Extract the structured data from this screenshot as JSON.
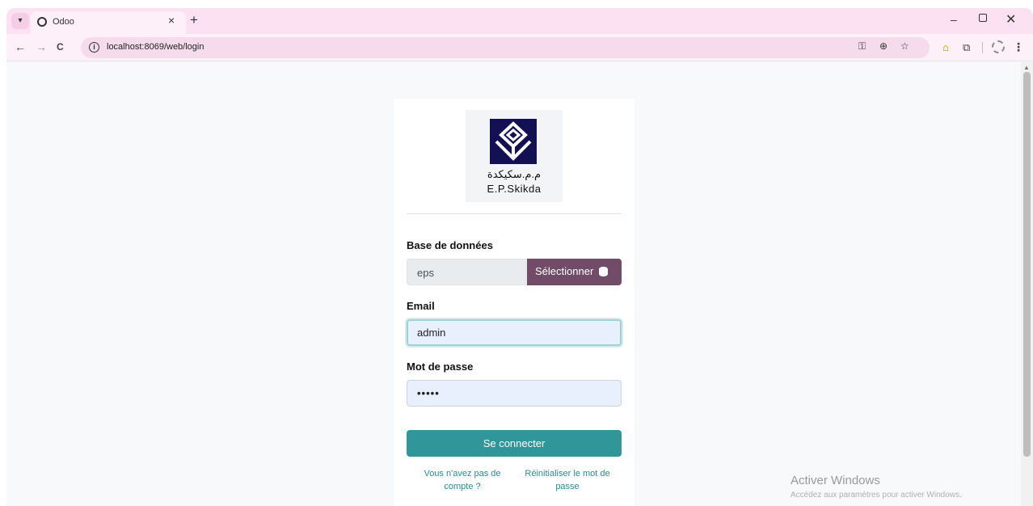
{
  "browser": {
    "tab_title": "Odoo",
    "tab_close": "×",
    "new_tab": "+",
    "url": "localhost:8069/web/login",
    "window_min": "–",
    "window_close": "✕",
    "nav_back": "←",
    "nav_forward": "→",
    "nav_reload": "C"
  },
  "icons": {
    "tab_dropdown": "chevron-down-icon",
    "key": "key-icon",
    "zoom": "zoom-icon",
    "star": "star-icon",
    "extension": "extension-icon",
    "puzzle": "puzzle-icon",
    "profile": "profile-icon",
    "menu": "menu-dots-icon"
  },
  "login": {
    "logo_arabic": "م.م.سكيكدة",
    "logo_latin": "E.P.Skikda",
    "db_label": "Base de données",
    "db_value": "eps",
    "db_select_label": "Sélectionner",
    "email_label": "Email",
    "email_value": "admin",
    "password_label": "Mot de passe",
    "password_value": "•••••",
    "submit_label": "Se connecter",
    "signup_link": "Vous n'avez pas de compte ?",
    "reset_link": "Réinitialiser le mot de passe"
  },
  "watermark": {
    "title": "Activer Windows",
    "subtitle": "Accédez aux paramètres pour activer Windows."
  },
  "colors": {
    "primary": "#31969a",
    "secondary": "#714b67",
    "logo_bg": "#131153"
  }
}
